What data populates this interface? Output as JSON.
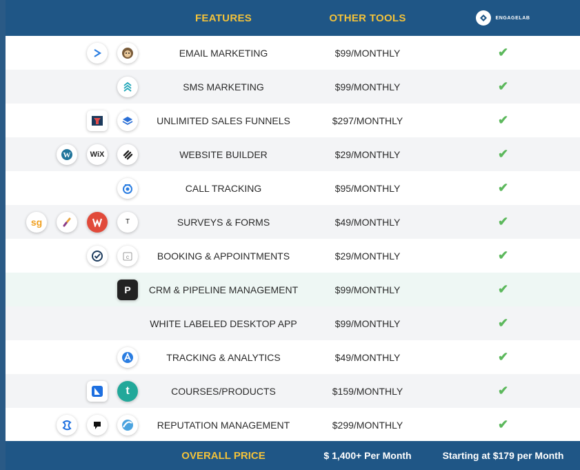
{
  "header": {
    "features_label": "FEATURES",
    "other_tools_label": "OTHER TOOLS",
    "brand_name": "ENGAGELAB"
  },
  "rows": [
    {
      "feature": "EMAIL MARKETING",
      "price": "$99/MONTHLY",
      "icons": [
        "activecampaign-icon",
        "mailchimp-icon"
      ]
    },
    {
      "feature": "SMS MARKETING",
      "price": "$99/MONTHLY",
      "icons": [
        "sms-tool-icon"
      ]
    },
    {
      "feature": "UNLIMITED SALES FUNNELS",
      "price": "$297/MONTHLY",
      "icons": [
        "clickfunnels-icon",
        "leadpages-icon"
      ]
    },
    {
      "feature": "WEBSITE BUILDER",
      "price": "$29/MONTHLY",
      "icons": [
        "wordpress-icon",
        "wix-icon",
        "squarespace-icon"
      ]
    },
    {
      "feature": "CALL TRACKING",
      "price": "$95/MONTHLY",
      "icons": [
        "calltracking-icon"
      ]
    },
    {
      "feature": "SURVEYS & FORMS",
      "price": "$49/MONTHLY",
      "icons": [
        "surveygizmo-icon",
        "formstack-icon",
        "wufoo-icon",
        "typeform-icon"
      ]
    },
    {
      "feature": "BOOKING & APPOINTMENTS",
      "price": "$29/MONTHLY",
      "icons": [
        "acuity-icon",
        "calendly-icon"
      ]
    },
    {
      "feature": "CRM & PIPELINE MANAGEMENT",
      "price": "$99/MONTHLY",
      "icons": [
        "pipedrive-icon"
      ]
    },
    {
      "feature": "WHITE LABELED DESKTOP APP",
      "price": "$99/MONTHLY",
      "icons": []
    },
    {
      "feature": "TRACKING & ANALYTICS",
      "price": "$49/MONTHLY",
      "icons": [
        "analytics-icon"
      ]
    },
    {
      "feature": "COURSES/PRODUCTS",
      "price": "$159/MONTHLY",
      "icons": [
        "kajabi-icon",
        "teachable-icon"
      ]
    },
    {
      "feature": "REPUTATION MANAGEMENT",
      "price": "$299/MONTHLY",
      "icons": [
        "birdeye-icon",
        "podium-icon",
        "reputation-icon"
      ]
    }
  ],
  "icon_glyphs": {
    "wix": "WiX",
    "pipedrive": "P",
    "surveygizmo": "sg",
    "teachable": "t",
    "typeform": "T"
  },
  "check_glyph": "✔",
  "footer": {
    "overall_label": "OVERALL PRICE",
    "other_total": "$ 1,400+ Per Month",
    "engagelab_total": "Starting at $179 per Month"
  },
  "colors": {
    "header_bg": "#1f5686",
    "accent_gold": "#f3c23a",
    "check_green": "#5cb85c"
  }
}
